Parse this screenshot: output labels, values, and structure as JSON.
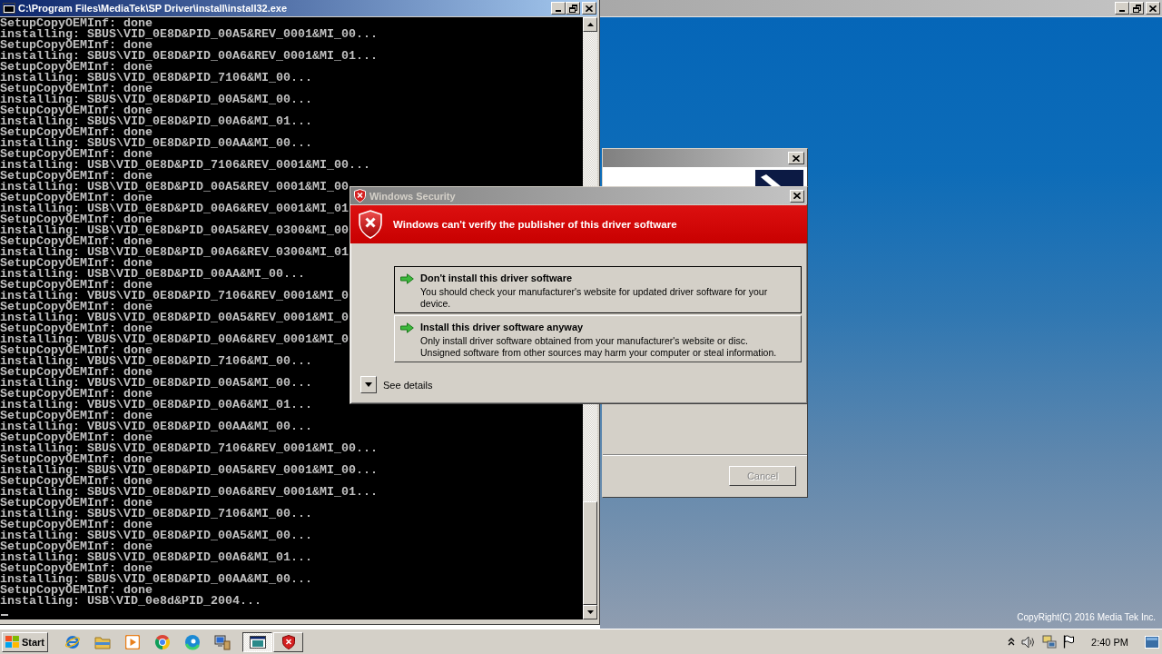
{
  "installer_window": {
    "active": false,
    "copyright": "CopyRight(C) 2016 Media Tek Inc."
  },
  "console_window": {
    "title": "C:\\Program Files\\MediaTek\\SP Driver\\install\\install32.exe",
    "active": true,
    "lines": [
      "SetupCopyOEMInf: done",
      "installing: SBUS\\VID_0E8D&PID_00A5&REV_0001&MI_00...",
      "SetupCopyOEMInf: done",
      "installing: SBUS\\VID_0E8D&PID_00A6&REV_0001&MI_01...",
      "SetupCopyOEMInf: done",
      "installing: SBUS\\VID_0E8D&PID_7106&MI_00...",
      "SetupCopyOEMInf: done",
      "installing: SBUS\\VID_0E8D&PID_00A5&MI_00...",
      "SetupCopyOEMInf: done",
      "installing: SBUS\\VID_0E8D&PID_00A6&MI_01...",
      "SetupCopyOEMInf: done",
      "installing: SBUS\\VID_0E8D&PID_00AA&MI_00...",
      "SetupCopyOEMInf: done",
      "installing: USB\\VID_0E8D&PID_7106&REV_0001&MI_00...",
      "SetupCopyOEMInf: done",
      "installing: USB\\VID_0E8D&PID_00A5&REV_0001&MI_00",
      "SetupCopyOEMInf: done",
      "installing: USB\\VID_0E8D&PID_00A6&REV_0001&MI_01",
      "SetupCopyOEMInf: done",
      "installing: USB\\VID_0E8D&PID_00A5&REV_0300&MI_00",
      "SetupCopyOEMInf: done",
      "installing: USB\\VID_0E8D&PID_00A6&REV_0300&MI_01",
      "SetupCopyOEMInf: done",
      "installing: USB\\VID_0E8D&PID_00AA&MI_00...",
      "SetupCopyOEMInf: done",
      "installing: VBUS\\VID_0E8D&PID_7106&REV_0001&MI_0",
      "SetupCopyOEMInf: done",
      "installing: VBUS\\VID_0E8D&PID_00A5&REV_0001&MI_0",
      "SetupCopyOEMInf: done",
      "installing: VBUS\\VID_0E8D&PID_00A6&REV_0001&MI_0",
      "SetupCopyOEMInf: done",
      "installing: VBUS\\VID_0E8D&PID_7106&MI_00...",
      "SetupCopyOEMInf: done",
      "installing: VBUS\\VID_0E8D&PID_00A5&MI_00...",
      "SetupCopyOEMInf: done",
      "installing: VBUS\\VID_0E8D&PID_00A6&MI_01...",
      "SetupCopyOEMInf: done",
      "installing: VBUS\\VID_0E8D&PID_00AA&MI_00...",
      "SetupCopyOEMInf: done",
      "installing: SBUS\\VID_0E8D&PID_7106&REV_0001&MI_00...",
      "SetupCopyOEMInf: done",
      "installing: SBUS\\VID_0E8D&PID_00A5&REV_0001&MI_00...",
      "SetupCopyOEMInf: done",
      "installing: SBUS\\VID_0E8D&PID_00A6&REV_0001&MI_01...",
      "SetupCopyOEMInf: done",
      "installing: SBUS\\VID_0E8D&PID_7106&MI_00...",
      "SetupCopyOEMInf: done",
      "installing: SBUS\\VID_0E8D&PID_00A5&MI_00...",
      "SetupCopyOEMInf: done",
      "installing: SBUS\\VID_0E8D&PID_00A6&MI_01...",
      "SetupCopyOEMInf: done",
      "installing: SBUS\\VID_0E8D&PID_00AA&MI_00...",
      "SetupCopyOEMInf: done",
      "installing: USB\\VID_0e8d&PID_2004..."
    ],
    "cursor_visible": true
  },
  "setup_dialog": {
    "active": false,
    "buttons": [
      {
        "label": "Cancel",
        "disabled": true
      }
    ]
  },
  "security_dialog": {
    "title": "Windows Security",
    "active": false,
    "heading": "Windows can't verify the publisher of this driver software",
    "options": [
      {
        "title": "Don't install this driver software",
        "description": "You should check your manufacturer's website for updated driver software for your device.",
        "selected": true
      },
      {
        "title": "Install this driver software anyway",
        "description": "Only install driver software obtained from your manufacturer's website or disc. Unsigned software from other sources may harm your computer or steal information.",
        "selected": false
      }
    ],
    "details_toggle": {
      "label": "See details",
      "expanded": false
    }
  },
  "taskbar": {
    "start_label": "Start",
    "task_buttons": [
      {
        "kind": "console",
        "selected": true
      },
      {
        "kind": "security",
        "selected": false
      }
    ],
    "clock": "2:40 PM"
  }
}
